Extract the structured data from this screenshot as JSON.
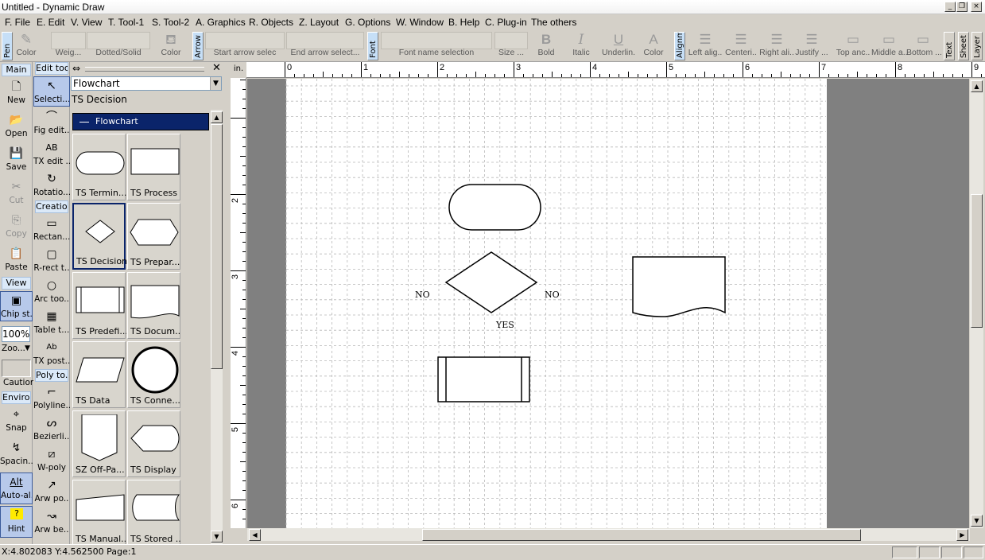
{
  "window": {
    "title": "Untitled - Dynamic Draw",
    "controls": [
      "_",
      "❐",
      "×"
    ]
  },
  "menu": [
    "F. File",
    "E. Edit",
    "V. View",
    "T. Tool-1",
    "S. Tool-2",
    "A. Graphics",
    "R. Objects",
    "Z. Layout",
    "G. Options",
    "W. Window",
    "B. Help",
    "C. Plug-in",
    "The others"
  ],
  "toolbar": {
    "pen_tab": "Pen",
    "pen_color": "Color",
    "pen_weight": "Weig...",
    "pen_style": "Dotted/Solid",
    "fill_color": "Color",
    "arrow_tab": "Arrow",
    "start_arrow": "Start arrow selec",
    "end_arrow": "End arrow select...",
    "font_tab": "Font",
    "font_name": "Font name selection",
    "font_size": "Size ...",
    "bold": "Bold",
    "italic": "Italic",
    "underline": "Underlin.",
    "text_color": "Color",
    "align_tab": "Alignm.",
    "align_left": "Left alig..",
    "align_center": "Centeri..",
    "align_right": "Right ali..",
    "justify": "Justify ...",
    "top_anchor": "Top anc..",
    "middle_anchor": "Middle a..",
    "bottom_anchor": "Bottom ...",
    "text_tab": "Text",
    "sheet_tab": "Sheet",
    "layer_tab": "Layer"
  },
  "main_tools": {
    "header": "Main",
    "new": "New",
    "open": "Open",
    "save": "Save",
    "cut": "Cut",
    "copy": "Copy",
    "paste": "Paste",
    "view_header": "View",
    "chip": "Chip st..",
    "zoom_value": "100%",
    "zoom": "Zoo...",
    "caution": "Caution",
    "env_header": "Enviro...",
    "snap": "Snap",
    "spacing": "Spacin...",
    "auto_align": "Auto-al...",
    "alt_glyph": "Alt",
    "hint": "Hint"
  },
  "edit_tools": {
    "header": "Edit too.",
    "selection": "Selecti...",
    "fig_edit": "Fig edit..",
    "tx_edit": "TX edit ..",
    "rotation": "Rotatio...",
    "creation_header": "Creatio...",
    "rectangle": "Rectan...",
    "rrect": "R-rect t..",
    "arc": "Arc too..",
    "table": "Table t...",
    "tx_post": "TX post..",
    "poly_header": "Poly to...",
    "polyline": "Polyline..",
    "bezier": "Bezierli...",
    "wpoly": "W-poly",
    "arw_po": "Arw po..",
    "arw_be": "Arw be.."
  },
  "panel": {
    "category": "Flowchart",
    "current_shape": "TS Decision",
    "group": "Flowchart",
    "shapes": [
      "TS Termin...",
      "TS Process",
      "TS Decision",
      "TS Prepar...",
      "TS Predefi...",
      "TS Docum...",
      "TS Data",
      "TS Conne...",
      "SZ Off-Pa...",
      "TS Display",
      "TS Manual...",
      "TS Stored ..."
    ]
  },
  "ruler": {
    "unit": "in.",
    "top": [
      "0",
      "1",
      "2",
      "3",
      "4",
      "5",
      "6",
      "7",
      "8",
      "9"
    ],
    "left": [
      "2",
      "3",
      "4",
      "5",
      "6"
    ]
  },
  "canvas": {
    "labels": {
      "no_left": "NO",
      "no_right": "NO",
      "yes": "YES"
    }
  },
  "status": {
    "text": "X:4.802083 Y:4.562500 Page:1"
  }
}
